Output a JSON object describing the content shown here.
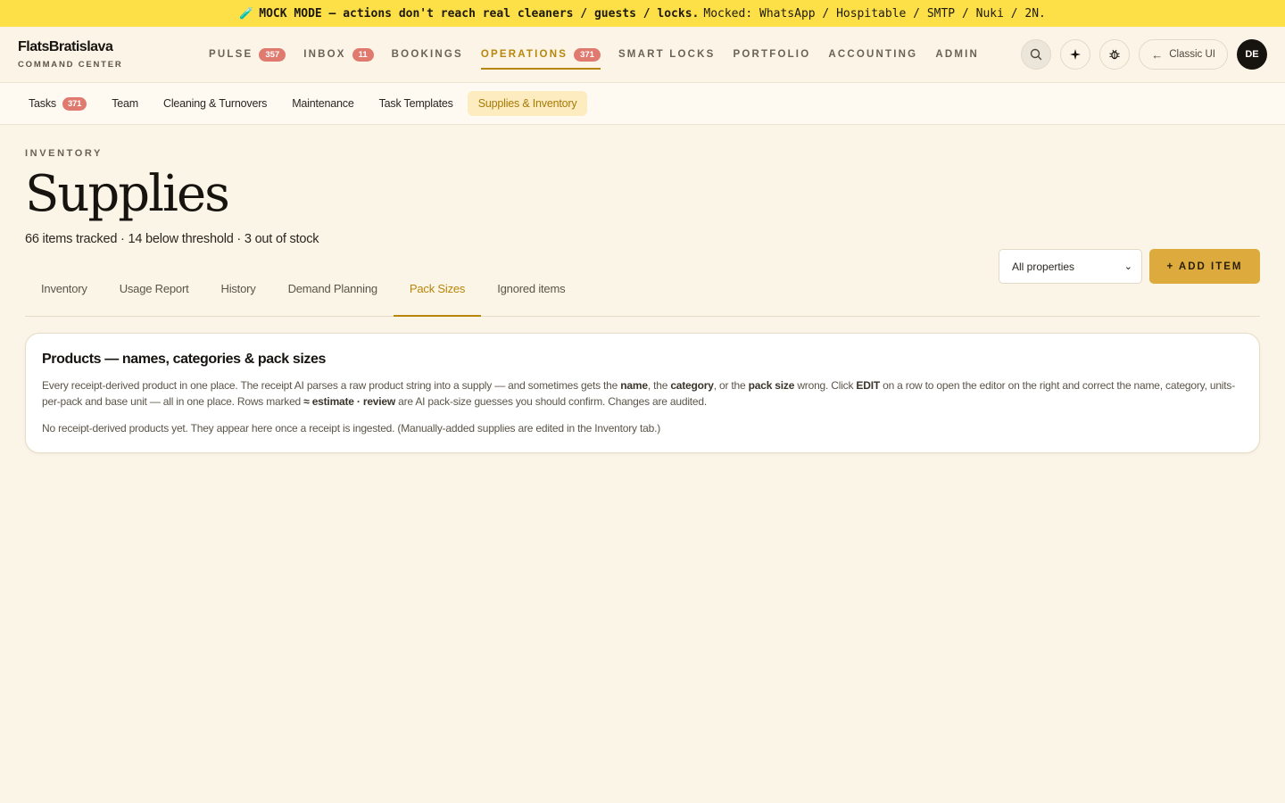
{
  "banner": {
    "icon": "test-tube-icon",
    "emoji": "🧪",
    "strong": "MOCK MODE — actions don't reach real cleaners / guests / locks.",
    "rest": "Mocked: WhatsApp / Hospitable / SMTP / Nuki / 2N."
  },
  "brand": {
    "name": "FlatsBratislava",
    "subtitle": "COMMAND CENTER"
  },
  "nav": [
    {
      "label": "PULSE",
      "badge": "357"
    },
    {
      "label": "INBOX",
      "badge": "11"
    },
    {
      "label": "BOOKINGS",
      "badge": ""
    },
    {
      "label": "OPERATIONS",
      "badge": "371",
      "active": true
    },
    {
      "label": "SMART LOCKS",
      "badge": ""
    },
    {
      "label": "PORTFOLIO",
      "badge": ""
    },
    {
      "label": "ACCOUNTING",
      "badge": ""
    },
    {
      "label": "ADMIN",
      "badge": ""
    }
  ],
  "top_actions": {
    "classic_label": "Classic UI",
    "avatar": "DE",
    "icons": [
      "search-icon",
      "sparkle-icon",
      "bug-icon"
    ]
  },
  "subnav": [
    {
      "label": "Tasks",
      "badge": "371"
    },
    {
      "label": "Team"
    },
    {
      "label": "Cleaning & Turnovers"
    },
    {
      "label": "Maintenance"
    },
    {
      "label": "Task Templates"
    },
    {
      "label": "Supplies & Inventory",
      "active": true
    }
  ],
  "page": {
    "eyebrow": "INVENTORY",
    "title": "Supplies",
    "summary": "66 items tracked · 14 below threshold · 3 out of stock",
    "property_select": "All properties",
    "add_label": "+ ADD ITEM"
  },
  "tabs": [
    {
      "label": "Inventory"
    },
    {
      "label": "Usage Report"
    },
    {
      "label": "History"
    },
    {
      "label": "Demand Planning"
    },
    {
      "label": "Pack Sizes",
      "active": true
    },
    {
      "label": "Ignored items"
    }
  ],
  "card": {
    "title": "Products — names, categories & pack sizes",
    "desc_1": "Every receipt-derived product in one place. The receipt AI parses a raw product string into a supply — and sometimes gets the ",
    "desc_b1": "name",
    "desc_2": ", the ",
    "desc_b2": "category",
    "desc_3": ", or the ",
    "desc_b3": "pack size",
    "desc_4": " wrong. Click ",
    "desc_b4": "EDIT",
    "desc_5": " on a row to open the editor on the right and correct the name, category, units-per-pack and base unit — all in one place. Rows marked ",
    "desc_b5": "≈ estimate · review",
    "desc_6": " are AI pack-size guesses you should confirm. Changes are audited.",
    "empty": "No receipt-derived products yet. They appear here once a receipt is ingested. (Manually-added supplies are edited in the Inventory tab.)"
  }
}
